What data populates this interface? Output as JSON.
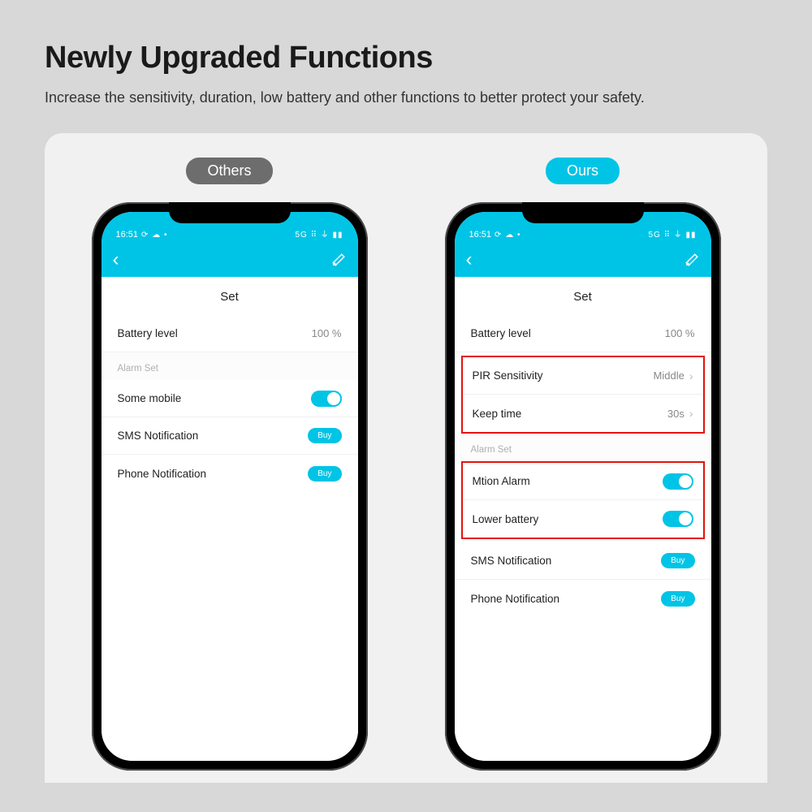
{
  "headline": "Newly Upgraded Functions",
  "subline": "Increase the sensitivity, duration, low battery and other functions to better protect your safety.",
  "badges": {
    "others": "Others",
    "ours": "Ours"
  },
  "status": {
    "time": "16:51",
    "left_extra": "⟳ ☁ •",
    "right_extra": "5G ⠿ ⏚ ▮▮"
  },
  "nav": {
    "title": "Set"
  },
  "others": {
    "rows": {
      "battery_label": "Battery level",
      "battery_value": "100 %",
      "alarm_section": "Alarm Set",
      "some_mobile": "Some mobile",
      "sms": "SMS Notification",
      "phone": "Phone Notification",
      "buy": "Buy"
    }
  },
  "ours": {
    "rows": {
      "battery_label": "Battery level",
      "battery_value": "100 %",
      "pir_label": "PIR Sensitivity",
      "pir_value": "Middle",
      "keep_label": "Keep time",
      "keep_value": "30s",
      "alarm_section": "Alarm Set",
      "motion": "Mtion Alarm",
      "lowbat": "Lower battery",
      "sms": "SMS Notification",
      "phone": "Phone Notification",
      "buy": "Buy"
    }
  }
}
